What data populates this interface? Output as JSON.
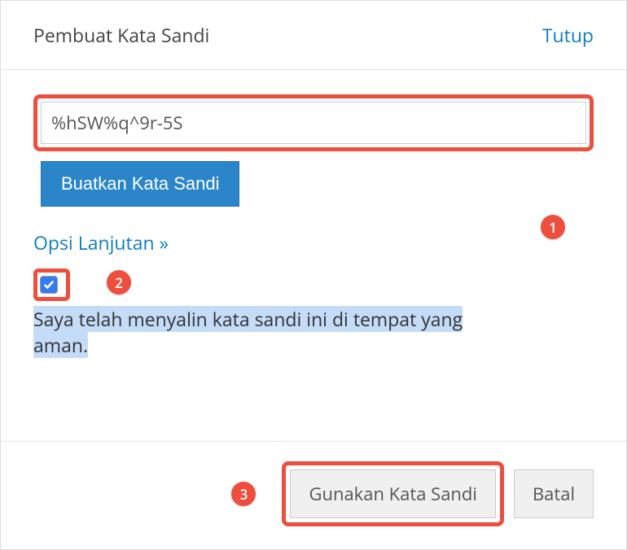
{
  "header": {
    "title": "Pembuat Kata Sandi",
    "close": "Tutup"
  },
  "body": {
    "password_value": "%hSW%q^9r-5S",
    "generate_label": "Buatkan Kata Sandi",
    "advanced_label": "Opsi Lanjutan »",
    "confirm_checked": true,
    "confirm_text_1": "Saya telah menyalin kata sandi ini di tempat yang",
    "confirm_text_2": "aman."
  },
  "footer": {
    "use_label": "Gunakan Kata Sandi",
    "cancel_label": "Batal"
  },
  "annotations": {
    "b1": "1",
    "b2": "2",
    "b3": "3"
  },
  "colors": {
    "accent_red": "#ee4e3e",
    "link_blue": "#0e7ec1",
    "btn_blue": "#2b85c9",
    "highlight": "#c4dcf8"
  }
}
